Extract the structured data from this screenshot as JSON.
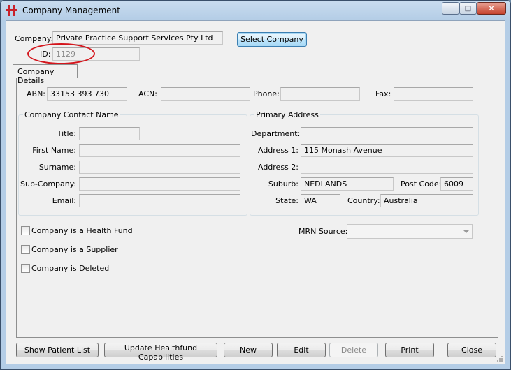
{
  "window": {
    "title": "Company Management",
    "controls": [
      "minimize",
      "maximize",
      "close"
    ]
  },
  "header": {
    "company_label": "Company:",
    "company_value": "Private Practice Support Services Pty Ltd",
    "id_label": "ID:",
    "id_value": "1129",
    "select_company_label": "Select Company"
  },
  "tabs": [
    {
      "label": "Company Details",
      "active": true
    }
  ],
  "details": {
    "abn_label": "ABN:",
    "abn_value": "33153 393 730",
    "acn_label": "ACN:",
    "acn_value": "",
    "phone_label": "Phone:",
    "phone_value": "",
    "fax_label": "Fax:",
    "fax_value": ""
  },
  "contact": {
    "legend": "Company Contact Name",
    "title_label": "Title:",
    "title_value": "",
    "first_name_label": "First Name:",
    "first_name_value": "",
    "surname_label": "Surname:",
    "surname_value": "",
    "sub_company_label": "Sub-Company:",
    "sub_company_value": "",
    "email_label": "Email:",
    "email_value": ""
  },
  "address": {
    "legend": "Primary Address",
    "department_label": "Department:",
    "department_value": "",
    "address1_label": "Address 1:",
    "address1_value": "115 Monash Avenue",
    "address2_label": "Address 2:",
    "address2_value": "",
    "suburb_label": "Suburb:",
    "suburb_value": "NEDLANDS",
    "postcode_label": "Post Code:",
    "postcode_value": "6009",
    "state_label": "State:",
    "state_value": "WA",
    "country_label": "Country:",
    "country_value": "Australia"
  },
  "flags": {
    "health_fund_label": "Company is a Health Fund",
    "health_fund_checked": false,
    "supplier_label": "Company is a Supplier",
    "supplier_checked": false,
    "deleted_label": "Company is Deleted",
    "deleted_checked": false
  },
  "mrn": {
    "label": "MRN Source:",
    "value": ""
  },
  "buttons": {
    "show_patient_list": "Show Patient List",
    "update_healthfund": "Update Healthfund Capabilities",
    "new": "New",
    "edit": "Edit",
    "delete": "Delete",
    "print": "Print",
    "close": "Close"
  },
  "colors": {
    "annotation_ellipse": "#d4151c",
    "title_bar": "#b4cde6",
    "client_bg": "#f0f0f0"
  }
}
